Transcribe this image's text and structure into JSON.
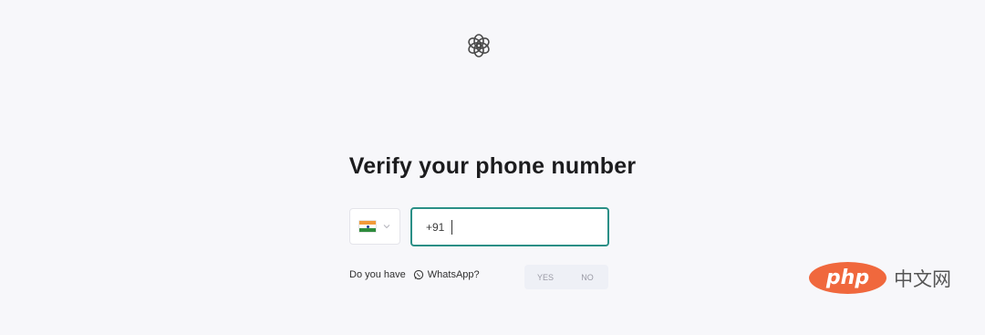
{
  "page": {
    "title": "Verify your phone number"
  },
  "logo": {
    "icon": "openai-logo-icon"
  },
  "phone": {
    "country_flag": "india-flag-icon",
    "dial_code": "+91"
  },
  "whatsapp": {
    "prefix": "Do you have",
    "label": "WhatsApp?",
    "option_yes": "YES",
    "option_no": "NO"
  },
  "watermark": {
    "badge": "php",
    "text": "中文网"
  },
  "colors": {
    "background": "#f7f7fa",
    "input_focus_border": "#2a8f86",
    "watermark_badge": "#f0683d"
  }
}
